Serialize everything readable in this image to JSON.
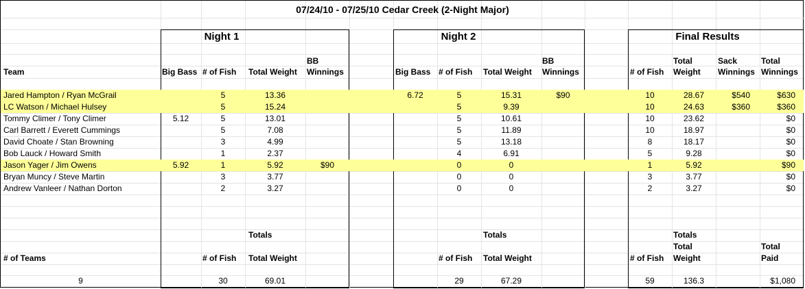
{
  "title": "07/24/10 - 07/25/10 Cedar Creek (2-Night Major)",
  "sections": {
    "night1": "Night 1",
    "night2": "Night 2",
    "final": "Final Results"
  },
  "headers": {
    "team": "Team",
    "big_bass": "Big Bass",
    "num_fish": "# of Fish",
    "total_weight": "Total Weight",
    "bb_line1": "BB",
    "bb_line2": "Winnings",
    "total_line1": "Total",
    "weight_line2": "Weight",
    "sack_line1": "Sack",
    "winnings_line2": "Winnings"
  },
  "rows": [
    {
      "team": "Jared Hampton / Ryan McGrail",
      "hl": true,
      "n1_bb": "",
      "n1_fish": "5",
      "n1_wt": "13.36",
      "n1_win": "",
      "n2_bb": "6.72",
      "n2_fish": "5",
      "n2_wt": "15.31",
      "n2_win": "$90",
      "f_fish": "10",
      "f_wt": "28.67",
      "f_sack": "$540",
      "f_total": "$630"
    },
    {
      "team": "LC Watson / Michael Hulsey",
      "hl": true,
      "n1_bb": "",
      "n1_fish": "5",
      "n1_wt": "15.24",
      "n1_win": "",
      "n2_bb": "",
      "n2_fish": "5",
      "n2_wt": "9.39",
      "n2_win": "",
      "f_fish": "10",
      "f_wt": "24.63",
      "f_sack": "$360",
      "f_total": "$360"
    },
    {
      "team": "Tommy Climer / Tony Climer",
      "hl": false,
      "n1_bb": "5.12",
      "n1_fish": "5",
      "n1_wt": "13.01",
      "n1_win": "",
      "n2_bb": "",
      "n2_fish": "5",
      "n2_wt": "10.61",
      "n2_win": "",
      "f_fish": "10",
      "f_wt": "23.62",
      "f_sack": "",
      "f_total": "$0"
    },
    {
      "team": "Carl Barrett / Everett Cummings",
      "hl": false,
      "n1_bb": "",
      "n1_fish": "5",
      "n1_wt": "7.08",
      "n1_win": "",
      "n2_bb": "",
      "n2_fish": "5",
      "n2_wt": "11.89",
      "n2_win": "",
      "f_fish": "10",
      "f_wt": "18.97",
      "f_sack": "",
      "f_total": "$0"
    },
    {
      "team": "David Choate / Stan Browning",
      "hl": false,
      "n1_bb": "",
      "n1_fish": "3",
      "n1_wt": "4.99",
      "n1_win": "",
      "n2_bb": "",
      "n2_fish": "5",
      "n2_wt": "13.18",
      "n2_win": "",
      "f_fish": "8",
      "f_wt": "18.17",
      "f_sack": "",
      "f_total": "$0"
    },
    {
      "team": "Bob Lauck / Howard Smith",
      "hl": false,
      "n1_bb": "",
      "n1_fish": "1",
      "n1_wt": "2.37",
      "n1_win": "",
      "n2_bb": "",
      "n2_fish": "4",
      "n2_wt": "6.91",
      "n2_win": "",
      "f_fish": "5",
      "f_wt": "9.28",
      "f_sack": "",
      "f_total": "$0"
    },
    {
      "team": "Jason Yager / Jim Owens",
      "hl": true,
      "n1_bb": "5.92",
      "n1_fish": "1",
      "n1_wt": "5.92",
      "n1_win": "$90",
      "n2_bb": "",
      "n2_fish": "0",
      "n2_wt": "0",
      "n2_win": "",
      "f_fish": "1",
      "f_wt": "5.92",
      "f_sack": "",
      "f_total": "$90"
    },
    {
      "team": "Bryan Muncy / Steve Martin",
      "hl": false,
      "n1_bb": "",
      "n1_fish": "3",
      "n1_wt": "3.77",
      "n1_win": "",
      "n2_bb": "",
      "n2_fish": "0",
      "n2_wt": "0",
      "n2_win": "",
      "f_fish": "3",
      "f_wt": "3.77",
      "f_sack": "",
      "f_total": "$0"
    },
    {
      "team": "Andrew Vanleer / Nathan Dorton",
      "hl": false,
      "n1_bb": "",
      "n1_fish": "2",
      "n1_wt": "3.27",
      "n1_win": "",
      "n2_bb": "",
      "n2_fish": "0",
      "n2_wt": "0",
      "n2_win": "",
      "f_fish": "2",
      "f_wt": "3.27",
      "f_sack": "",
      "f_total": "$0"
    }
  ],
  "totals": {
    "label": "Totals",
    "num_teams_label": "# of Teams",
    "num_fish_label": "# of Fish",
    "total_weight_label": "Total Weight",
    "total_label": "Total",
    "weight_label": "Weight",
    "paid_label": "Paid",
    "num_teams": "9",
    "n1_fish": "30",
    "n1_wt": "69.01",
    "n2_fish": "29",
    "n2_wt": "67.29",
    "f_fish": "59",
    "f_wt": "136.3",
    "f_paid": "$1,080"
  },
  "colors": {
    "highlight": "#ffff99",
    "grid": "#e3e3e3"
  }
}
